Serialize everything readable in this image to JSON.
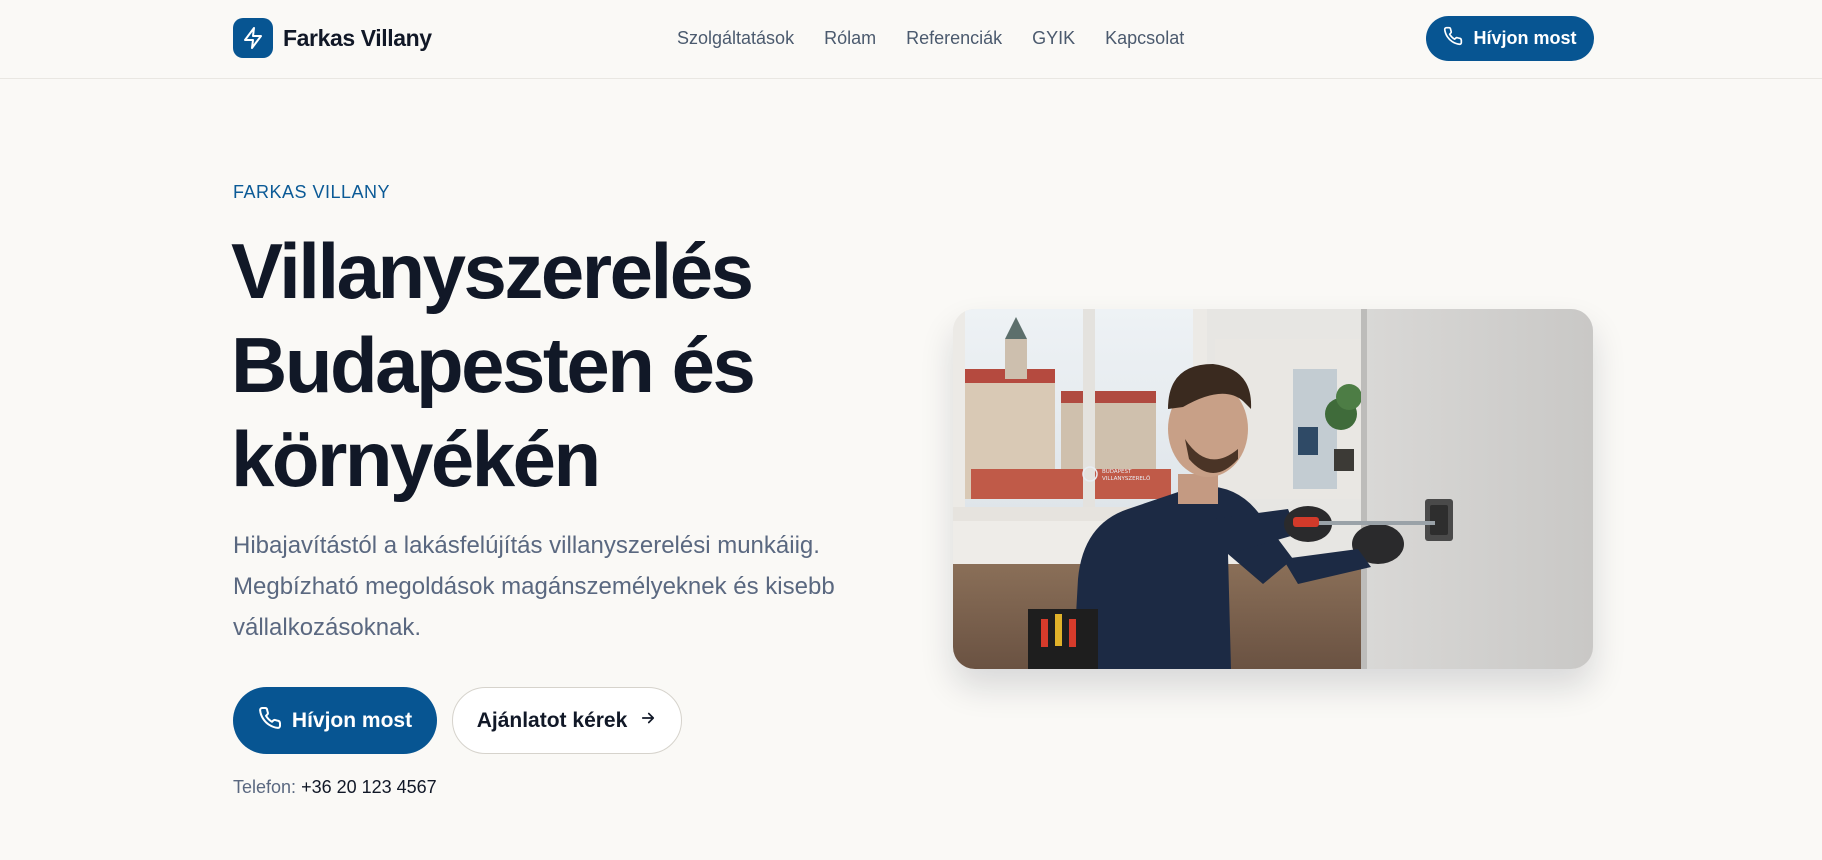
{
  "brand": {
    "name": "Farkas Villany",
    "icon": "bolt-icon",
    "color": "#075592"
  },
  "nav": {
    "items": [
      {
        "label": "Szolgáltatások"
      },
      {
        "label": "Rólam"
      },
      {
        "label": "Referenciák"
      },
      {
        "label": "GYIK"
      },
      {
        "label": "Kapcsolat"
      }
    ]
  },
  "header": {
    "cta_label": "Hívjon most",
    "cta_icon": "phone-icon"
  },
  "hero": {
    "eyebrow": "FARKAS VILLANY",
    "headline_lines": [
      "Villanyszerelés",
      "Budapesten és",
      "környékén"
    ],
    "lead_lines": [
      "Hibajavítástól a lakásfelújítás villanyszerelési munkáiig.",
      "Megbízható megoldások magánszemélyeknek és kisebb",
      "vállalkozásoknak."
    ],
    "primary_cta_label": "Hívjon most",
    "secondary_cta_label": "Ajánlatot kérek",
    "secondary_cta_icon": "arrow-right-icon",
    "phone_label": "Telefon:",
    "phone_number": "+36 20 123 4567",
    "image": {
      "subject": "electrician-installing-wall-socket-photo",
      "shirt_logo_line1": "BUDAPEST",
      "shirt_logo_line2": "VILLANYSZERELŐ"
    }
  }
}
